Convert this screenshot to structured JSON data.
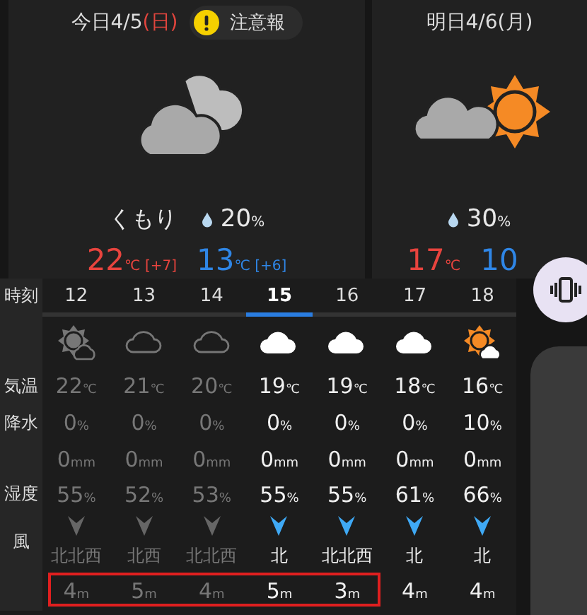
{
  "today": {
    "label": "今日4/5",
    "weekday": "(日)",
    "warning": "注意報",
    "kind": "cloud",
    "condition": "くもり",
    "rain_chance": "20",
    "rain_unit": "%",
    "high": "22",
    "high_unit": "℃",
    "high_diff": "[+7]",
    "low": "13",
    "low_unit": "℃",
    "low_diff": "[+6]"
  },
  "tomorrow": {
    "label": "明日4/6(月)",
    "kind": "sun_cloud",
    "rain_chance": "30",
    "rain_unit": "%",
    "high": "17",
    "high_unit": "℃",
    "low": "10"
  },
  "row_labels": [
    "時刻",
    "気温",
    "降水",
    "湿度",
    "風"
  ],
  "hours": [
    {
      "time": "12",
      "selected": false,
      "past": true,
      "kind": "sun_cloud",
      "temp": "22",
      "temp_unit": "℃",
      "precip": "0",
      "precip_unit": "%",
      "rain": "0",
      "rain_unit": "mm",
      "humidity": "55",
      "humidity_unit": "%",
      "wind_dir": "北北西",
      "wind_speed": "4",
      "wind_unit": "m",
      "highlighted": true
    },
    {
      "time": "13",
      "selected": false,
      "past": true,
      "kind": "cloud_outline",
      "temp": "21",
      "temp_unit": "℃",
      "precip": "0",
      "precip_unit": "%",
      "rain": "0",
      "rain_unit": "mm",
      "humidity": "52",
      "humidity_unit": "%",
      "wind_dir": "北西",
      "wind_speed": "5",
      "wind_unit": "m",
      "highlighted": true
    },
    {
      "time": "14",
      "selected": false,
      "past": true,
      "kind": "cloud_outline",
      "temp": "20",
      "temp_unit": "℃",
      "precip": "0",
      "precip_unit": "%",
      "rain": "0",
      "rain_unit": "mm",
      "humidity": "53",
      "humidity_unit": "%",
      "wind_dir": "北北西",
      "wind_speed": "4",
      "wind_unit": "m",
      "highlighted": true
    },
    {
      "time": "15",
      "selected": true,
      "past": false,
      "kind": "cloud",
      "temp": "19",
      "temp_unit": "℃",
      "precip": "0",
      "precip_unit": "%",
      "rain": "0",
      "rain_unit": "mm",
      "humidity": "55",
      "humidity_unit": "%",
      "wind_dir": "北",
      "wind_speed": "5",
      "wind_unit": "m",
      "highlighted": true
    },
    {
      "time": "16",
      "selected": false,
      "past": false,
      "kind": "cloud",
      "temp": "19",
      "temp_unit": "℃",
      "precip": "0",
      "precip_unit": "%",
      "rain": "0",
      "rain_unit": "mm",
      "humidity": "55",
      "humidity_unit": "%",
      "wind_dir": "北北西",
      "wind_speed": "3",
      "wind_unit": "m",
      "highlighted": true
    },
    {
      "time": "17",
      "selected": false,
      "past": false,
      "kind": "cloud",
      "temp": "18",
      "temp_unit": "℃",
      "precip": "0",
      "precip_unit": "%",
      "rain": "0",
      "rain_unit": "mm",
      "humidity": "61",
      "humidity_unit": "%",
      "wind_dir": "北",
      "wind_speed": "4",
      "wind_unit": "m",
      "highlighted": false
    },
    {
      "time": "18",
      "selected": false,
      "past": false,
      "kind": "sun_cloud",
      "temp": "16",
      "temp_unit": "℃",
      "precip": "10",
      "precip_unit": "%",
      "rain": "0",
      "rain_unit": "mm",
      "humidity": "66",
      "humidity_unit": "%",
      "wind_dir": "北",
      "wind_speed": "4",
      "wind_unit": "m",
      "highlighted": false
    }
  ]
}
